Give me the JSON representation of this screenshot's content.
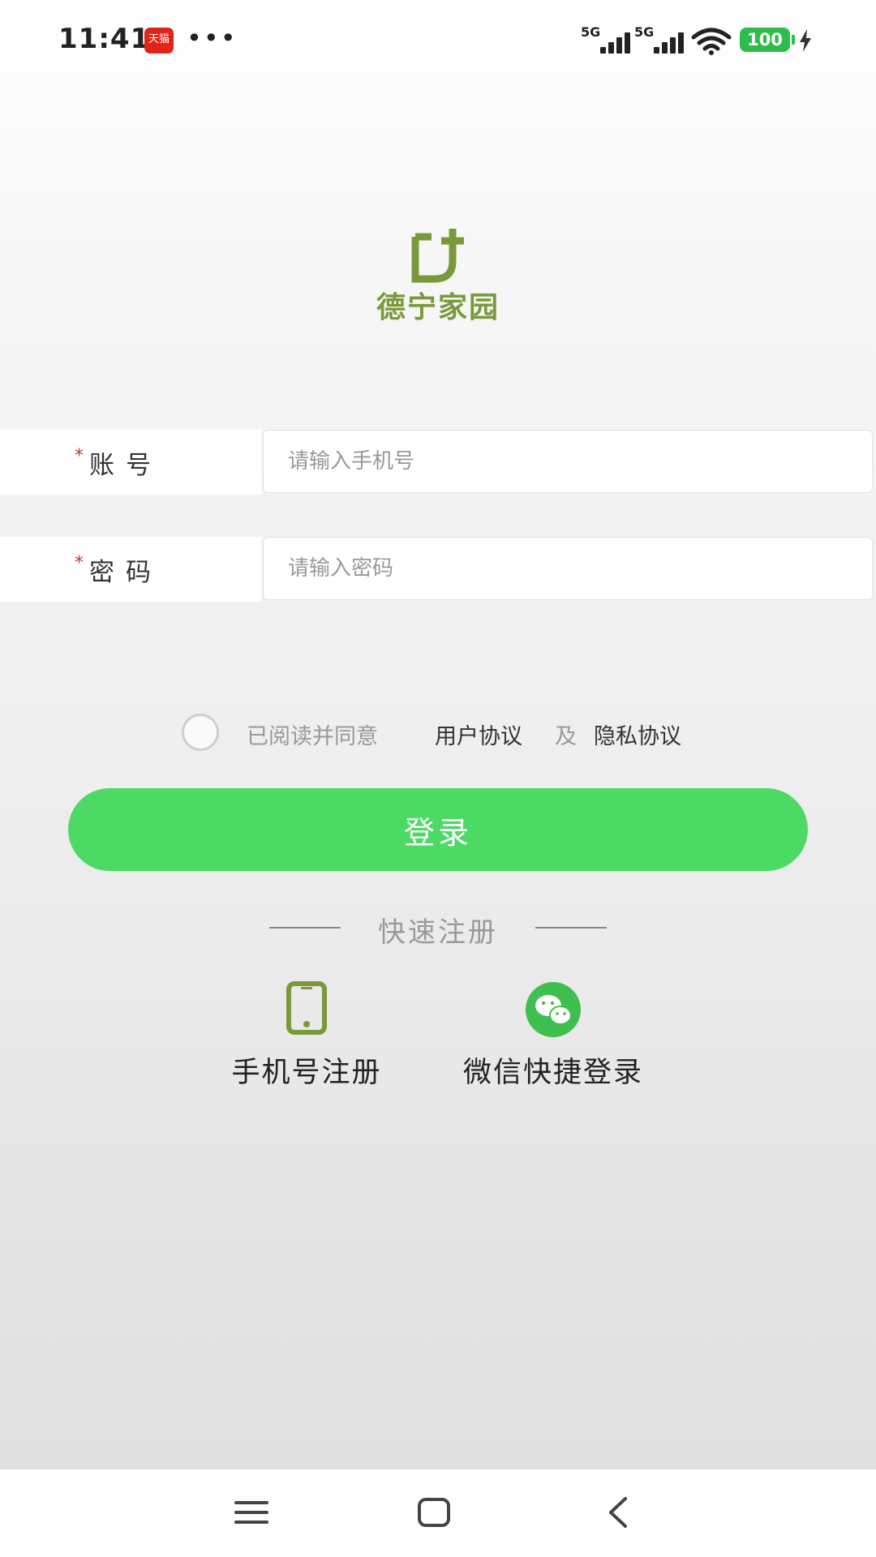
{
  "status_bar": {
    "time": "11:41",
    "app_badge": "天猫",
    "more": "•••",
    "signal1_label": "5G",
    "signal2_label": "5G",
    "battery": "100"
  },
  "brand": {
    "name": "德宁家园",
    "color": "#7a9a3a"
  },
  "form": {
    "account": {
      "required_mark": "*",
      "label": "账号",
      "placeholder": "请输入手机号",
      "value": ""
    },
    "password": {
      "required_mark": "*",
      "label": "密码",
      "placeholder": "请输入密码",
      "value": ""
    }
  },
  "agreement": {
    "checked": false,
    "prefix": "已阅读并同意",
    "user_agreement": "用户协议",
    "conjunction": "及",
    "privacy_agreement": "隐私协议"
  },
  "login_button": {
    "label": "登录",
    "color": "#4cd964"
  },
  "quick_register": {
    "title": "快速注册",
    "options": [
      {
        "label": "手机号注册",
        "icon": "phone-icon"
      },
      {
        "label": "微信快捷登录",
        "icon": "wechat-icon"
      }
    ]
  },
  "nav": {
    "icons": [
      "menu-icon",
      "home-icon",
      "back-icon"
    ]
  }
}
